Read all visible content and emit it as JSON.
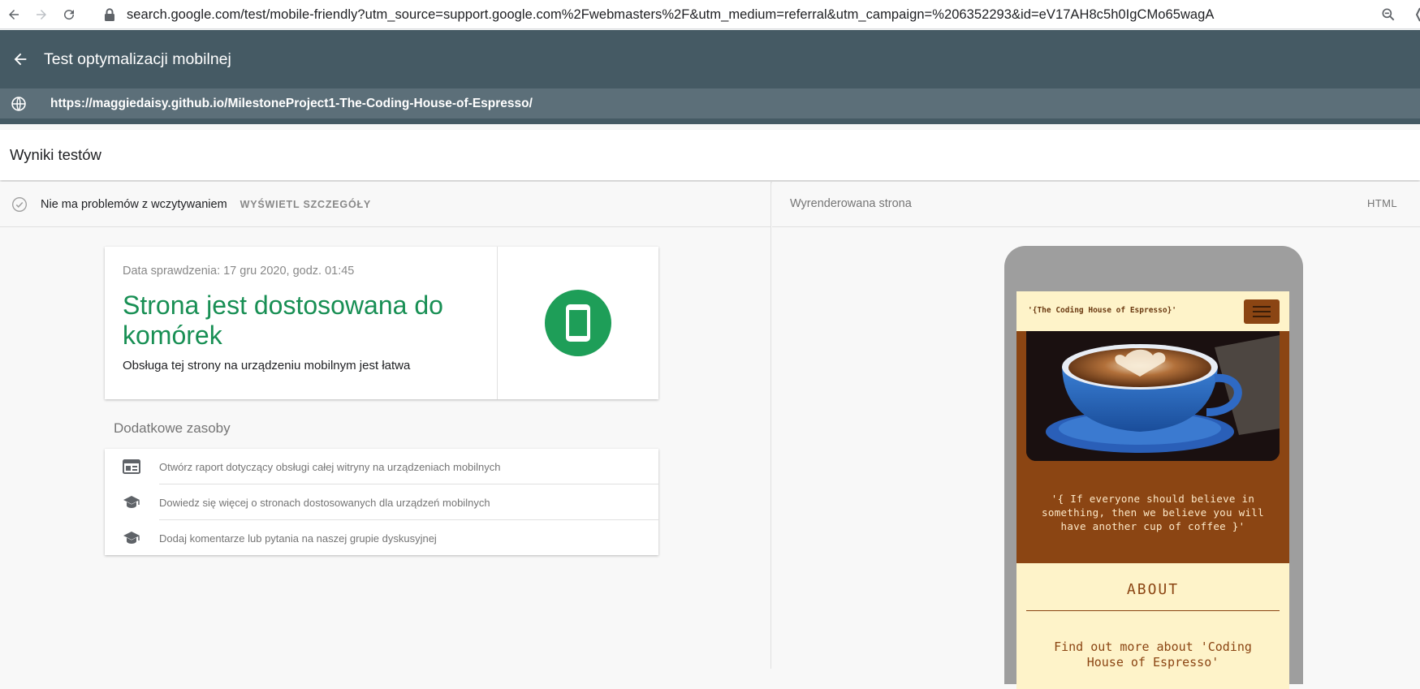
{
  "browser": {
    "url": "search.google.com/test/mobile-friendly?utm_source=support.google.com%2Fwebmasters%2F&utm_medium=referral&utm_campaign=%206352293&id=eV17AH8c5h0IgCMo65wagA"
  },
  "app": {
    "title": "Test optymalizacji mobilnej",
    "tested_url": "https://maggiedaisy.github.io/MilestoneProject1-The-Coding-House-of-Espresso/"
  },
  "results": {
    "header": "Wyniki testów",
    "status_text": "Nie ma problemów z wczytywaniem",
    "details_link": "WYŚWIETL SZCZEGÓŁY",
    "date": "Data sprawdzenia: 17 gru 2020, godz. 01:45",
    "headline": "Strona jest dostosowana do komórek",
    "subtext": "Obsługa tej strony na urządzeniu mobilnym jest łatwa",
    "status_color": "#188f54"
  },
  "resources": {
    "title": "Dodatkowe zasoby",
    "items": [
      {
        "icon": "report-icon",
        "label": "Otwórz raport dotyczący obsługi całej witryny na urządzeniach mobilnych"
      },
      {
        "icon": "graduation-cap-icon",
        "label": "Dowiedz się więcej o stronach dostosowanych dla urządzeń mobilnych"
      },
      {
        "icon": "graduation-cap-icon",
        "label": "Dodaj komentarze lub pytania na naszej grupie dyskusyjnej"
      }
    ]
  },
  "rendered": {
    "label": "Wyrenderowana strona",
    "html_link": "HTML",
    "site": {
      "brand": "'{The Coding House of Espresso}'",
      "quote": "'{ If everyone should believe in something, then we believe you will have another cup of coffee }'",
      "about_title": "ABOUT",
      "about_text": "Find out more about 'Coding House of Espresso'"
    }
  }
}
